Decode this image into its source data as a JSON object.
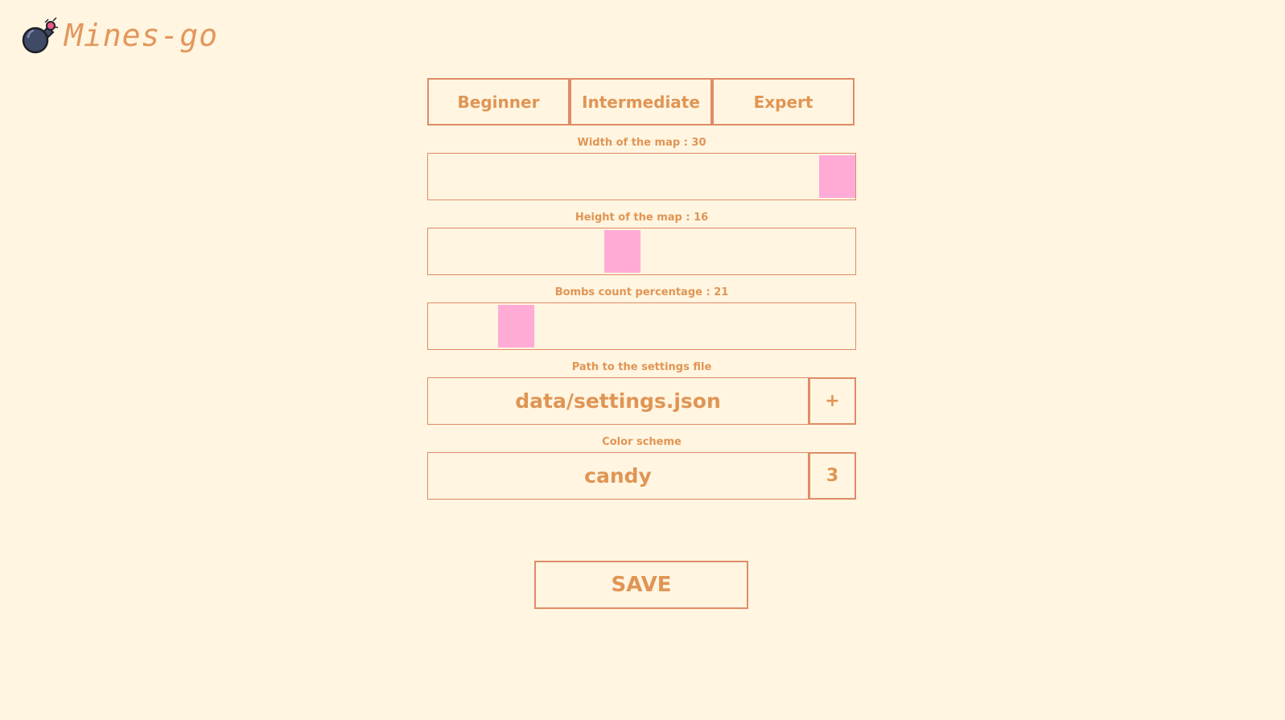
{
  "app": {
    "title": "Mines-go",
    "logo_icon": "bomb-icon"
  },
  "presets": [
    {
      "label": "Beginner"
    },
    {
      "label": "Intermediate"
    },
    {
      "label": "Expert"
    }
  ],
  "width_slider": {
    "label": "Width of the map : 30",
    "value": 30,
    "fraction": 1.0
  },
  "height_slider": {
    "label": "Height of the map : 16",
    "value": 16,
    "fraction": 0.45
  },
  "bombs_slider": {
    "label": "Bombs count percentage : 21",
    "value": 21,
    "fraction": 0.18
  },
  "settings_path": {
    "label": "Path to the settings file",
    "value": "data/settings.json",
    "button_label": "+"
  },
  "color_scheme": {
    "label": "Color scheme",
    "value": "candy",
    "button_label": "3"
  },
  "save_label": "SAVE",
  "colors": {
    "background": "#fff5e1",
    "accent": "#e09554",
    "border": "#df8c66",
    "slider_thumb": "#ffabd6"
  }
}
